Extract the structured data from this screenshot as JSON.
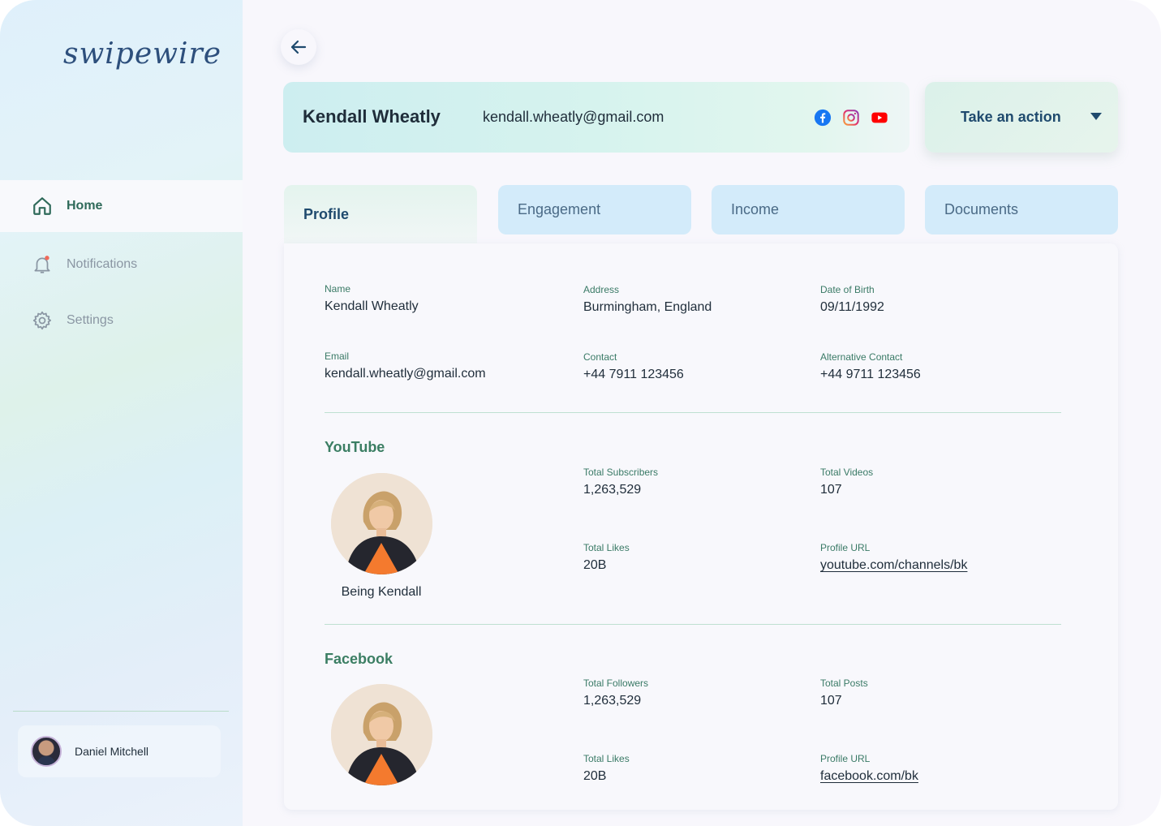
{
  "app": {
    "logo": "swipewire"
  },
  "sidebar": {
    "items": [
      {
        "label": "Home",
        "icon": "home-icon",
        "active": true
      },
      {
        "label": "Notifications",
        "icon": "bell-icon",
        "active": false
      },
      {
        "label": "Settings",
        "icon": "gear-icon",
        "active": false
      }
    ],
    "user": {
      "name": "Daniel Mitchell"
    }
  },
  "header": {
    "name": "Kendall Wheatly",
    "email": "kendall.wheatly@gmail.com",
    "socials": [
      "facebook-icon",
      "instagram-icon",
      "youtube-icon"
    ],
    "action_label": "Take an action"
  },
  "tabs": [
    {
      "label": "Profile",
      "active": true
    },
    {
      "label": "Engagement",
      "active": false
    },
    {
      "label": "Income",
      "active": false
    },
    {
      "label": "Documents",
      "active": false
    }
  ],
  "profile": {
    "name": {
      "label": "Name",
      "value": "Kendall Wheatly"
    },
    "address": {
      "label": "Address",
      "value": "Burmingham, England"
    },
    "dob": {
      "label": "Date of Birth",
      "value": "09/11/1992"
    },
    "email": {
      "label": "Email",
      "value": "kendall.wheatly@gmail.com"
    },
    "contact": {
      "label": "Contact",
      "value": "+44 7911 123456"
    },
    "alt_contact": {
      "label": "Alternative Contact",
      "value": "+44 9711 123456"
    }
  },
  "youtube": {
    "title": "YouTube",
    "channel_name": "Being Kendall",
    "subscribers": {
      "label": "Total Subscribers",
      "value": "1,263,529"
    },
    "videos": {
      "label": "Total Videos",
      "value": "107"
    },
    "likes": {
      "label": "Total Likes",
      "value": "20B"
    },
    "url": {
      "label": "Profile URL",
      "value": "youtube.com/channels/bk"
    }
  },
  "facebook": {
    "title": "Facebook",
    "followers": {
      "label": "Total Followers",
      "value": "1,263,529"
    },
    "posts": {
      "label": "Total Posts",
      "value": "107"
    },
    "likes": {
      "label": "Total Likes",
      "value": "20B"
    },
    "url": {
      "label": "Profile URL",
      "value": "facebook.com/bk"
    }
  },
  "colors": {
    "accent": "#3b7e63",
    "tab_inactive": "#d3ebfa",
    "heading": "#1f4a6e",
    "facebook": "#1877f2",
    "youtube": "#ff0000",
    "instagram": "#e1306c"
  }
}
